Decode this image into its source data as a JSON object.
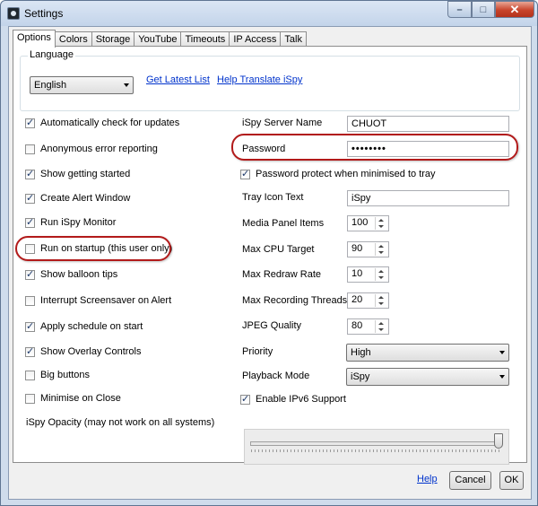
{
  "window": {
    "title": "Settings",
    "icon": "ispy-app-icon"
  },
  "titlebar_buttons": {
    "minimize": "–",
    "maximize": "□",
    "close": "✕"
  },
  "tabs": [
    {
      "label": "Options",
      "active": true
    },
    {
      "label": "Colors"
    },
    {
      "label": "Storage"
    },
    {
      "label": "YouTube"
    },
    {
      "label": "Timeouts"
    },
    {
      "label": "IP Access"
    },
    {
      "label": "Talk"
    }
  ],
  "language": {
    "group_label": "Language",
    "selected": "English",
    "get_latest_link": "Get Latest List",
    "help_translate_link": "Help Translate iSpy"
  },
  "left_options": [
    {
      "label": "Automatically check for updates",
      "checked": true
    },
    {
      "label": "Anonymous error reporting",
      "checked": false
    },
    {
      "label": "Show getting started",
      "checked": true
    },
    {
      "label": "Create Alert Window",
      "checked": true
    },
    {
      "label": "Run iSpy Monitor",
      "checked": true
    },
    {
      "label": "Run on startup (this user only)",
      "checked": false
    },
    {
      "label": "Show balloon tips",
      "checked": true
    },
    {
      "label": "Interrupt Screensaver on Alert",
      "checked": false
    },
    {
      "label": "Apply schedule on start",
      "checked": true
    },
    {
      "label": "Show Overlay Controls",
      "checked": true
    },
    {
      "label": "Big buttons",
      "checked": false
    },
    {
      "label": "Minimise on Close",
      "checked": false
    }
  ],
  "right": {
    "server_name_label": "iSpy Server Name",
    "server_name_value": "CHUOT",
    "password_label": "Password",
    "password_value": "••••••••",
    "password_protect_label": "Password protect when minimised to tray",
    "password_protect_checked": true,
    "tray_icon_label": "Tray Icon Text",
    "tray_icon_value": "iSpy",
    "media_panel_label": "Media Panel Items",
    "media_panel_value": "100",
    "max_cpu_label": "Max CPU Target",
    "max_cpu_value": "90",
    "max_redraw_label": "Max Redraw Rate",
    "max_redraw_value": "10",
    "max_threads_label": "Max Recording Threads",
    "max_threads_value": "20",
    "jpeg_label": "JPEG Quality",
    "jpeg_value": "80",
    "priority_label": "Priority",
    "priority_value": "High",
    "playback_label": "Playback Mode",
    "playback_value": "iSpy",
    "ipv6_label": "Enable IPv6 Support",
    "ipv6_checked": true
  },
  "opacity": {
    "label": "iSpy Opacity (may not work on all systems)",
    "level_percent": 100
  },
  "footer": {
    "help": "Help",
    "cancel": "Cancel",
    "ok": "OK"
  },
  "colors": {
    "highlight": "#b21a1a",
    "link": "#0033cc",
    "close_button": "#c8442b"
  }
}
